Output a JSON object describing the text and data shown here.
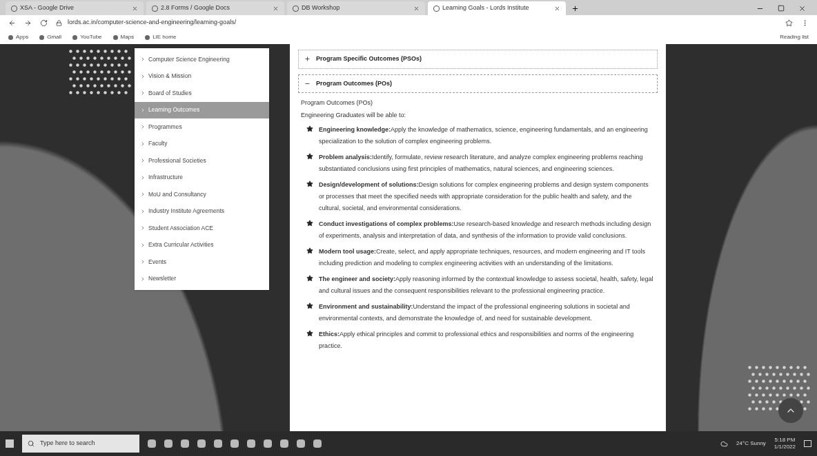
{
  "browser": {
    "tabs": [
      {
        "label": "XSA - Google Drive",
        "selected": false
      },
      {
        "label": "2.8 Forms / Google Docs",
        "selected": false
      },
      {
        "label": "DB Workshop",
        "selected": false
      },
      {
        "label": "Learning Goals - Lords Institute",
        "selected": true
      }
    ],
    "address": "lords.ac.in/computer-science-and-engineering/learning-goals/",
    "bookmarks": [
      "Apps",
      "Gmail",
      "YouTube",
      "Maps",
      "LIE home"
    ],
    "reading_list": "Reading list"
  },
  "menu": {
    "items": [
      {
        "label": "Computer Science Engineering",
        "selected": false
      },
      {
        "label": "Vision & Mission",
        "selected": false
      },
      {
        "label": "Board of Studies",
        "selected": false
      },
      {
        "label": "Learning Outcomes",
        "selected": true
      },
      {
        "label": "Programmes",
        "selected": false
      },
      {
        "label": "Faculty",
        "selected": false
      },
      {
        "label": "Professional Societies",
        "selected": false
      },
      {
        "label": "Infrastructure",
        "selected": false
      },
      {
        "label": "MoU and Consultancy",
        "selected": false
      },
      {
        "label": "Industry Institute Agreements",
        "selected": false
      },
      {
        "label": "Student Association ACE",
        "selected": false
      },
      {
        "label": "Extra Curricular Activities",
        "selected": false
      },
      {
        "label": "Events",
        "selected": false
      },
      {
        "label": "Newsletter",
        "selected": false
      }
    ]
  },
  "accordions": [
    {
      "title": "Program Specific Outcomes (PSOs)",
      "expanded": false
    },
    {
      "title": "Program Outcomes (POs)",
      "expanded": true
    }
  ],
  "content": {
    "heading": "Program Outcomes (POs)",
    "intro": "Engineering Graduates will be able to:",
    "outcomes": [
      "**Engineering knowledge:**Apply the knowledge of mathematics, science, engineering fundamentals, and an engineering specialization to the solution of complex engineering problems.",
      "**Problem analysis:**Identify, formulate, review research literature, and analyze complex engineering problems reaching substantiated conclusions using first principles of mathematics, natural sciences, and engineering sciences.",
      "**Design/development of solutions:**Design solutions for complex engineering problems and design system components or processes that meet the specified needs with appropriate consideration for the public health and safety, and the cultural, societal, and environmental considerations.",
      "**Conduct investigations of complex problems:**Use research-based knowledge and research methods including design of experiments, analysis and interpretation of data, and synthesis of the information to provide valid conclusions.",
      "**Modern tool usage:**Create, select, and apply appropriate techniques, resources, and modern engineering and IT tools including prediction and modeling to complex engineering activities with an understanding of the limitations.",
      "**The engineer and society:**Apply reasoning informed by the contextual knowledge to assess societal, health, safety, legal and cultural issues and the consequent responsibilities relevant to the professional engineering practice.",
      "**Environment and sustainability:**Understand the impact of the professional engineering solutions in societal and environmental contexts, and demonstrate the knowledge of, and need for sustainable development.",
      "**Ethics:**Apply ethical principles and commit to professional ethics and responsibilities and norms of the engineering practice."
    ]
  },
  "taskbar": {
    "search_placeholder": "Type here to search",
    "weather": "24°C Sunny",
    "time": "5:18 PM",
    "date": "1/1/2022"
  }
}
